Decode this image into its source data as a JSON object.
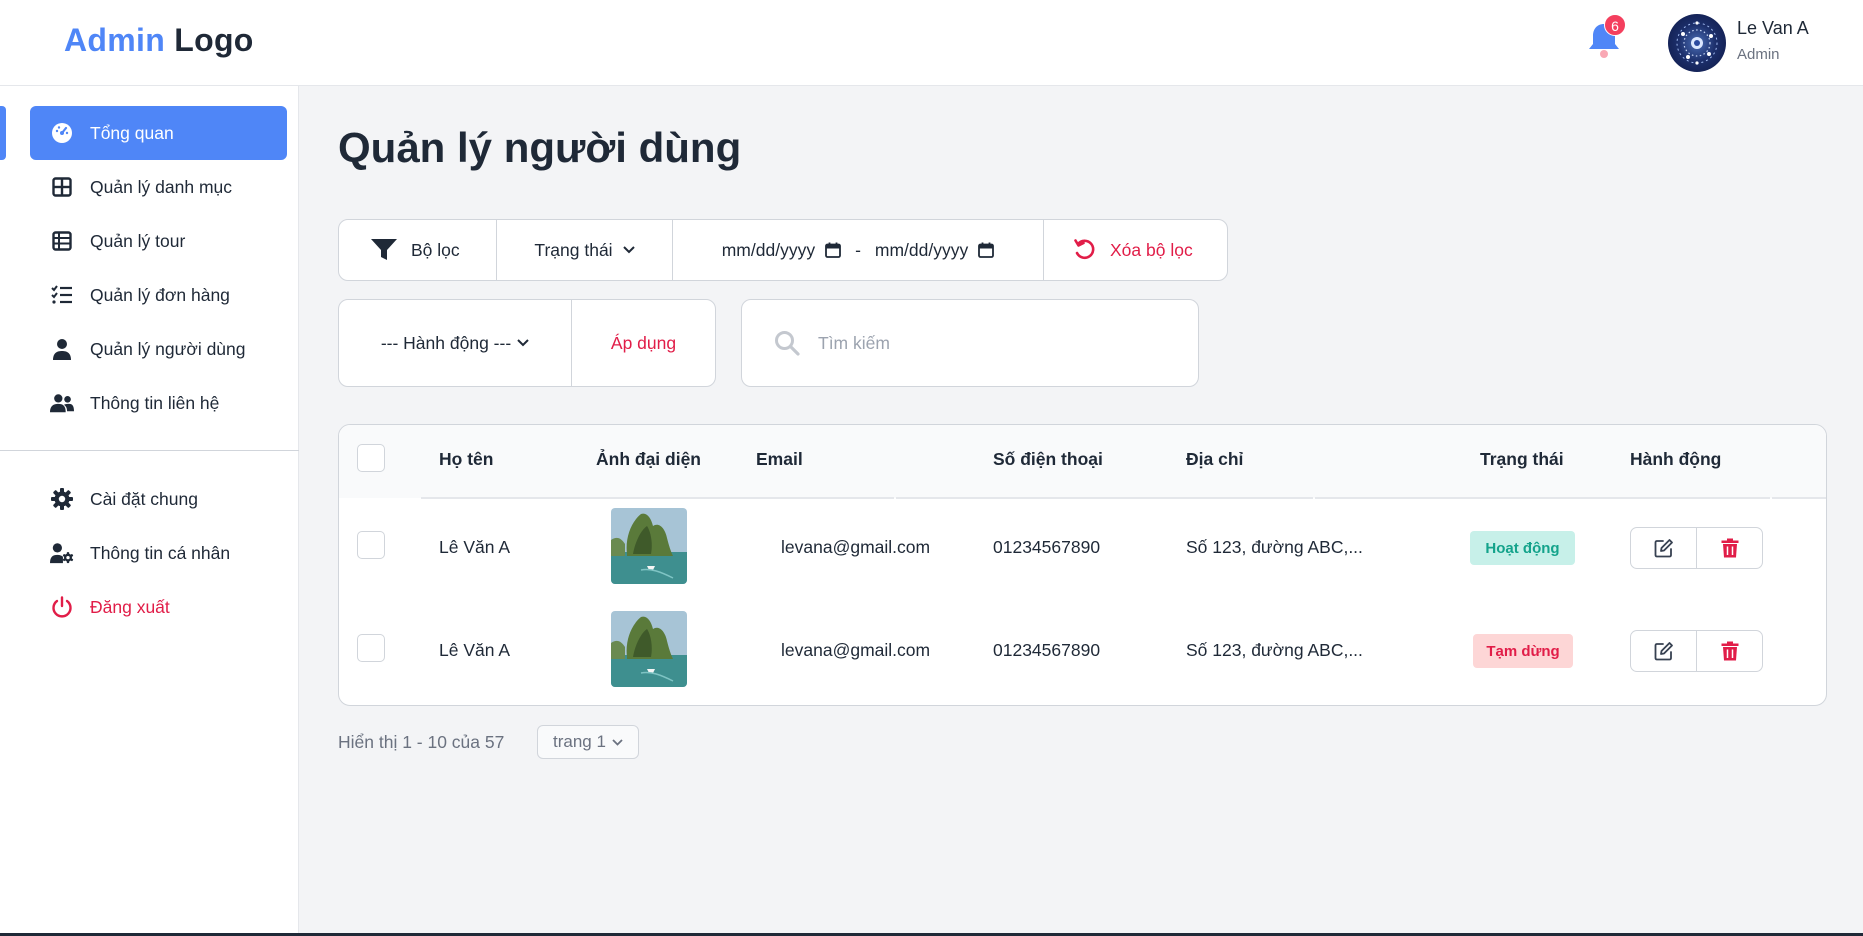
{
  "header": {
    "logo_part1": "Admin",
    "logo_part2": "Logo",
    "notification_count": "6",
    "user_name": "Le Van A",
    "user_role": "Admin"
  },
  "sidebar": {
    "items": [
      {
        "label": "Tổng quan",
        "icon": "dashboard-icon",
        "active": true
      },
      {
        "label": "Quản lý danh mục",
        "icon": "grid-icon"
      },
      {
        "label": "Quản lý tour",
        "icon": "table-icon"
      },
      {
        "label": "Quản lý đơn hàng",
        "icon": "list-check-icon"
      },
      {
        "label": "Quản lý người dùng",
        "icon": "user-icon"
      },
      {
        "label": "Thông tin liên hệ",
        "icon": "users-icon"
      }
    ],
    "bottom_items": [
      {
        "label": "Cài đặt chung",
        "icon": "gear-icon"
      },
      {
        "label": "Thông tin cá nhân",
        "icon": "user-gear-icon"
      },
      {
        "label": "Đăng xuất",
        "icon": "power-icon"
      }
    ]
  },
  "page": {
    "title": "Quản lý người dùng"
  },
  "filters": {
    "filter_label": "Bộ lọc",
    "status_label": "Trạng thái",
    "date_from": "mm/dd/yyyy",
    "date_separator": "-",
    "date_to": "mm/dd/yyyy",
    "clear_label": "Xóa bộ lọc"
  },
  "actions": {
    "select_label": "--- Hành động ---",
    "apply_label": "Áp dụng"
  },
  "search": {
    "placeholder": "Tìm kiếm"
  },
  "table": {
    "headers": {
      "name": "Họ tên",
      "avatar": "Ảnh đại diện",
      "email": "Email",
      "phone": "Số điện thoại",
      "address": "Địa chỉ",
      "status": "Trạng thái",
      "action": "Hành động"
    },
    "rows": [
      {
        "name": "Lê Văn A",
        "email": "levana@gmail.com",
        "phone": "01234567890",
        "address": "Số 123, đường ABC,...",
        "status": "Hoạt động",
        "status_color": "#14a38b"
      },
      {
        "name": "Lê Văn A",
        "email": "levana@gmail.com",
        "phone": "01234567890",
        "address": "Số 123, đường ABC,...",
        "status": "Tạm dừng",
        "status_color": "#e11d48"
      }
    ]
  },
  "pagination": {
    "info": "Hiển thị 1 - 10 của 57",
    "page_label": "trang 1"
  },
  "colors": {
    "primary": "#4f86f7",
    "danger": "#e11d48",
    "success": "#14a38b"
  }
}
